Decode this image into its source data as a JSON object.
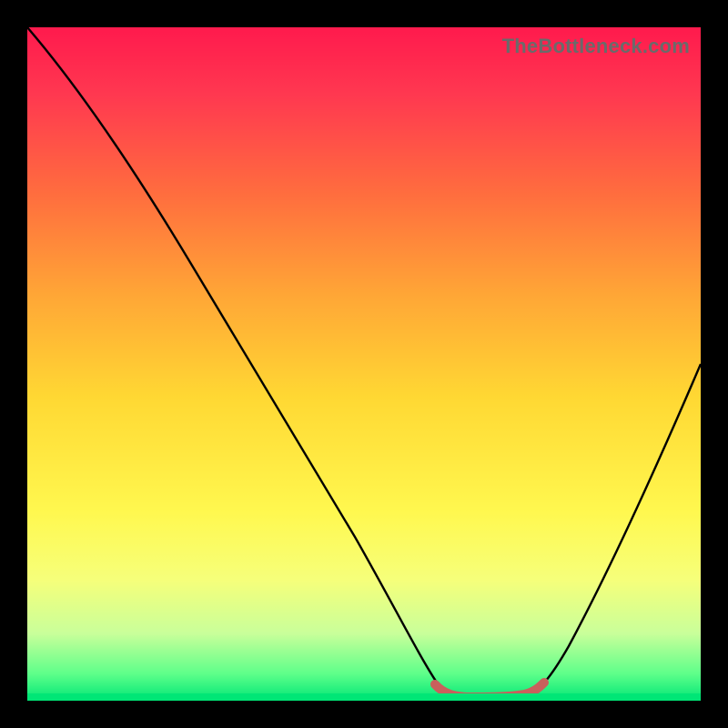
{
  "watermark": "TheBottleneck.com",
  "chart_data": {
    "type": "line",
    "title": "",
    "xlabel": "",
    "ylabel": "",
    "xlim": [
      0,
      100
    ],
    "ylim": [
      0,
      100
    ],
    "grid": false,
    "legend": false,
    "series": [
      {
        "name": "bottleneck-curve",
        "x": [
          0,
          6,
          12,
          18,
          24,
          30,
          36,
          42,
          48,
          54,
          58,
          62,
          66,
          70,
          74,
          78,
          82,
          88,
          94,
          100
        ],
        "y": [
          100,
          92,
          83,
          74,
          65,
          56,
          47,
          38,
          28,
          17,
          8,
          2,
          0,
          0,
          0,
          2,
          8,
          20,
          34,
          50
        ],
        "color": "#000000"
      },
      {
        "name": "min-band",
        "x": [
          60,
          64,
          68,
          72,
          76
        ],
        "y": [
          2.5,
          1.5,
          1.2,
          1.5,
          2.5
        ],
        "color": "#c9605c"
      }
    ]
  }
}
